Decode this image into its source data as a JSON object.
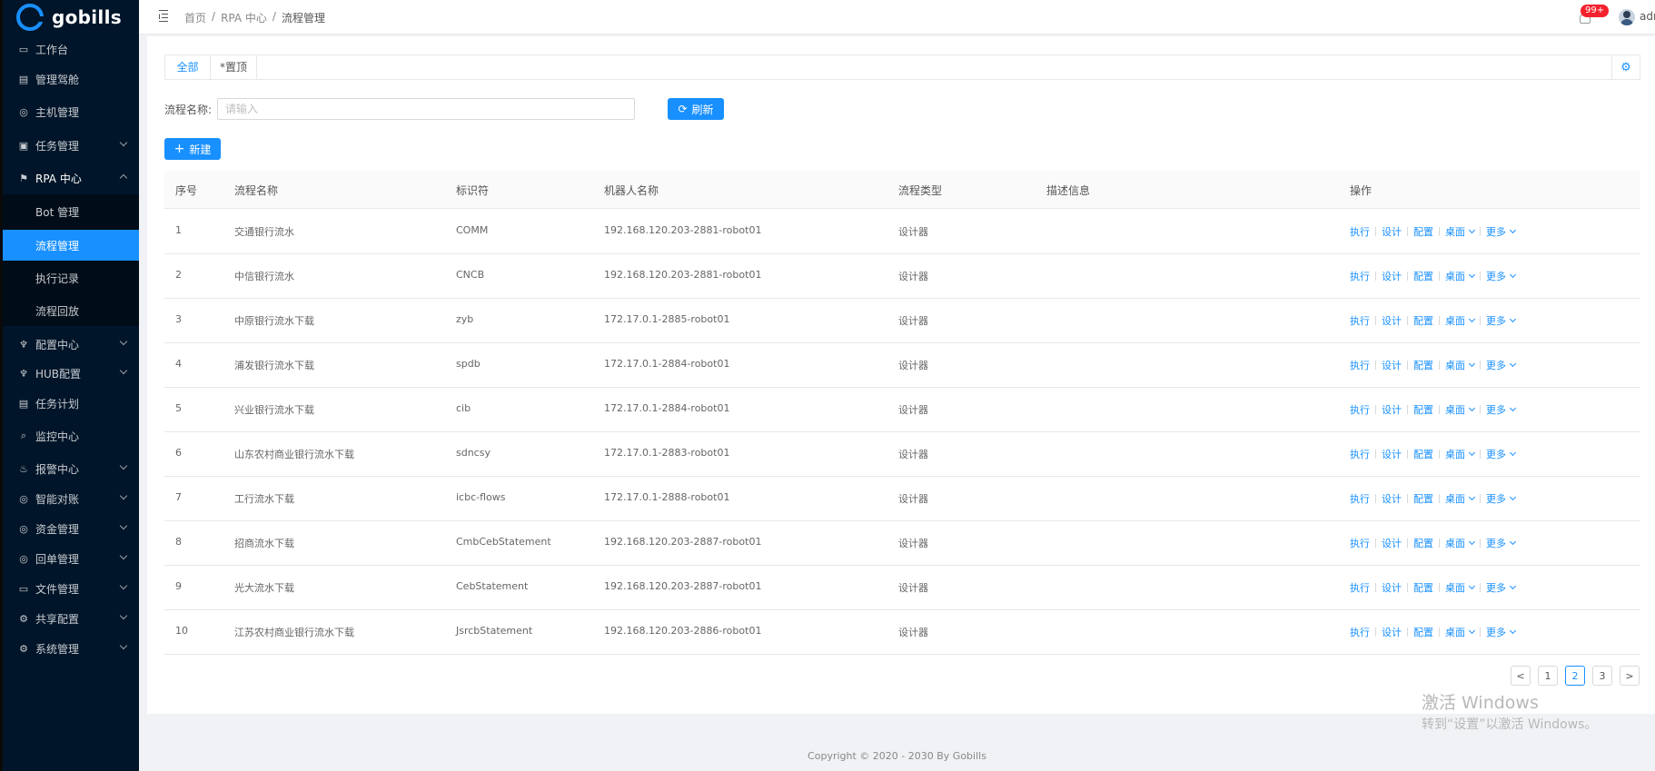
{
  "app": {
    "name": "gobills",
    "brand_color": "#1890ff",
    "sidebar_bg": "#001529"
  },
  "sidebar": {
    "items": [
      {
        "label": "工作台",
        "icon": "monitor-icon",
        "expandable": false
      },
      {
        "label": "管理驾舱",
        "icon": "dashboard-icon",
        "expandable": false
      },
      {
        "label": "主机管理",
        "icon": "host-icon",
        "expandable": false
      },
      {
        "label": "任务管理",
        "icon": "task-icon",
        "expandable": true
      },
      {
        "label": "RPA 中心",
        "icon": "rpa-icon",
        "expandable": true,
        "open": true
      },
      {
        "label": "Bot 管理",
        "sub": true
      },
      {
        "label": "流程管理",
        "sub": true,
        "active": true
      },
      {
        "label": "执行记录",
        "sub": true
      },
      {
        "label": "流程回放",
        "sub": true
      },
      {
        "label": "配置中心",
        "icon": "config-icon",
        "expandable": true
      },
      {
        "label": "HUB配置",
        "icon": "hub-icon",
        "expandable": true
      },
      {
        "label": "任务计划",
        "icon": "calendar-icon",
        "expandable": false
      },
      {
        "label": "监控中心",
        "icon": "monitor-search-icon",
        "expandable": false
      },
      {
        "label": "报警中心",
        "icon": "alarm-icon",
        "expandable": true
      },
      {
        "label": "智能对账",
        "icon": "reconcile-icon",
        "expandable": true
      },
      {
        "label": "资金管理",
        "icon": "fund-icon",
        "expandable": true
      },
      {
        "label": "回单管理",
        "icon": "receipt-icon",
        "expandable": true
      },
      {
        "label": "文件管理",
        "icon": "file-icon",
        "expandable": true
      },
      {
        "label": "共享配置",
        "icon": "share-gear-icon",
        "expandable": true
      },
      {
        "label": "系统管理",
        "icon": "settings-icon",
        "expandable": true
      }
    ]
  },
  "header": {
    "breadcrumb": [
      "首页",
      "RPA 中心",
      "流程管理"
    ],
    "breadcrumb_sep": "/",
    "notification_badge": "99+",
    "user_name": "adm"
  },
  "tabs": [
    {
      "label": "全部",
      "active": true
    },
    {
      "label": "*置顶",
      "active": false
    }
  ],
  "filter": {
    "label": "流程名称:",
    "placeholder": "请输入",
    "value": "",
    "refresh_label": "刷新"
  },
  "toolbar": {
    "new_label": "新建"
  },
  "table": {
    "columns": [
      "序号",
      "流程名称",
      "标识符",
      "机器人名称",
      "流程类型",
      "描述信息",
      "操作"
    ],
    "rows": [
      {
        "no": "1",
        "name": "交通银行流水",
        "id": "COMM",
        "robot": "192.168.120.203-2881-robot01",
        "type": "设计器",
        "desc": ""
      },
      {
        "no": "2",
        "name": "中信银行流水",
        "id": "CNCB",
        "robot": "192.168.120.203-2881-robot01",
        "type": "设计器",
        "desc": ""
      },
      {
        "no": "3",
        "name": "中原银行流水下载",
        "id": "zyb",
        "robot": "172.17.0.1-2885-robot01",
        "type": "设计器",
        "desc": ""
      },
      {
        "no": "4",
        "name": "浦发银行流水下载",
        "id": "spdb",
        "robot": "172.17.0.1-2884-robot01",
        "type": "设计器",
        "desc": ""
      },
      {
        "no": "5",
        "name": "兴业银行流水下载",
        "id": "cib",
        "robot": "172.17.0.1-2884-robot01",
        "type": "设计器",
        "desc": ""
      },
      {
        "no": "6",
        "name": "山东农村商业银行流水下载",
        "id": "sdncsy",
        "robot": "172.17.0.1-2883-robot01",
        "type": "设计器",
        "desc": ""
      },
      {
        "no": "7",
        "name": "工行流水下载",
        "id": "icbc-flows",
        "robot": "172.17.0.1-2888-robot01",
        "type": "设计器",
        "desc": ""
      },
      {
        "no": "8",
        "name": "招商流水下载",
        "id": "CmbCebStatement",
        "robot": "192.168.120.203-2887-robot01",
        "type": "设计器",
        "desc": ""
      },
      {
        "no": "9",
        "name": "光大流水下载",
        "id": "CebStatement",
        "robot": "192.168.120.203-2887-robot01",
        "type": "设计器",
        "desc": ""
      },
      {
        "no": "10",
        "name": "江苏农村商业银行流水下载",
        "id": "JsrcbStatement",
        "robot": "192.168.120.203-2886-robot01",
        "type": "设计器",
        "desc": ""
      }
    ],
    "actions": {
      "run": "执行",
      "design": "设计",
      "config": "配置",
      "desktop": "桌面",
      "more": "更多"
    }
  },
  "pagination": {
    "prev": "<",
    "next": ">",
    "pages": [
      "1",
      "2",
      "3"
    ],
    "current": "2"
  },
  "watermark": {
    "title": "激活 Windows",
    "subtitle": "转到“设置”以激活 Windows。"
  },
  "footer": {
    "copyright": "Copyright © 2020 - 2030 By Gobills"
  }
}
